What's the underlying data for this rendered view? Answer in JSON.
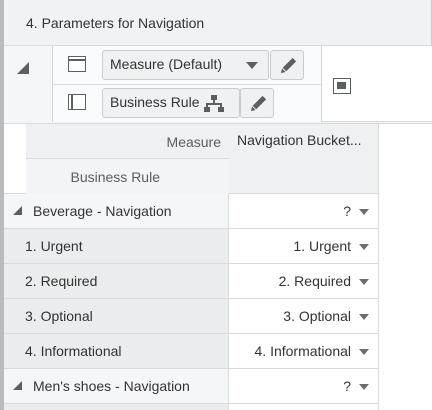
{
  "panel": {
    "title": "4. Parameters for Navigation"
  },
  "dimensions": {
    "columns_chip": {
      "label": "Measure (Default)",
      "icon": "table-columns-icon"
    },
    "rows_chip": {
      "label": "Business Rule",
      "icon": "table-rows-icon"
    },
    "edit_icon": "pencil-icon",
    "hierarchy_icon": "hierarchy-icon",
    "pivot_icon": "pivot-icon"
  },
  "grid": {
    "corner": {
      "measure_label": "Measure",
      "business_rule_label": "Business Rule"
    },
    "column_header": "Navigation Bucket...",
    "rows": [
      {
        "label": "Beverage - Navigation",
        "type": "group",
        "value": "?"
      },
      {
        "label": "1. Urgent",
        "type": "child",
        "value": "1. Urgent"
      },
      {
        "label": "2. Required",
        "type": "child",
        "value": "2. Required"
      },
      {
        "label": "3. Optional",
        "type": "child",
        "value": "3. Optional"
      },
      {
        "label": "4. Informational",
        "type": "child",
        "value": "4. Informational"
      },
      {
        "label": "Men's shoes - Navigation",
        "type": "group",
        "value": "?"
      }
    ]
  },
  "colors": {
    "group_row_bg": "#f5f6f7",
    "child_row_bg": "#eaeced",
    "header_bg": "#eef0f1",
    "icon": "#5c5f62"
  }
}
